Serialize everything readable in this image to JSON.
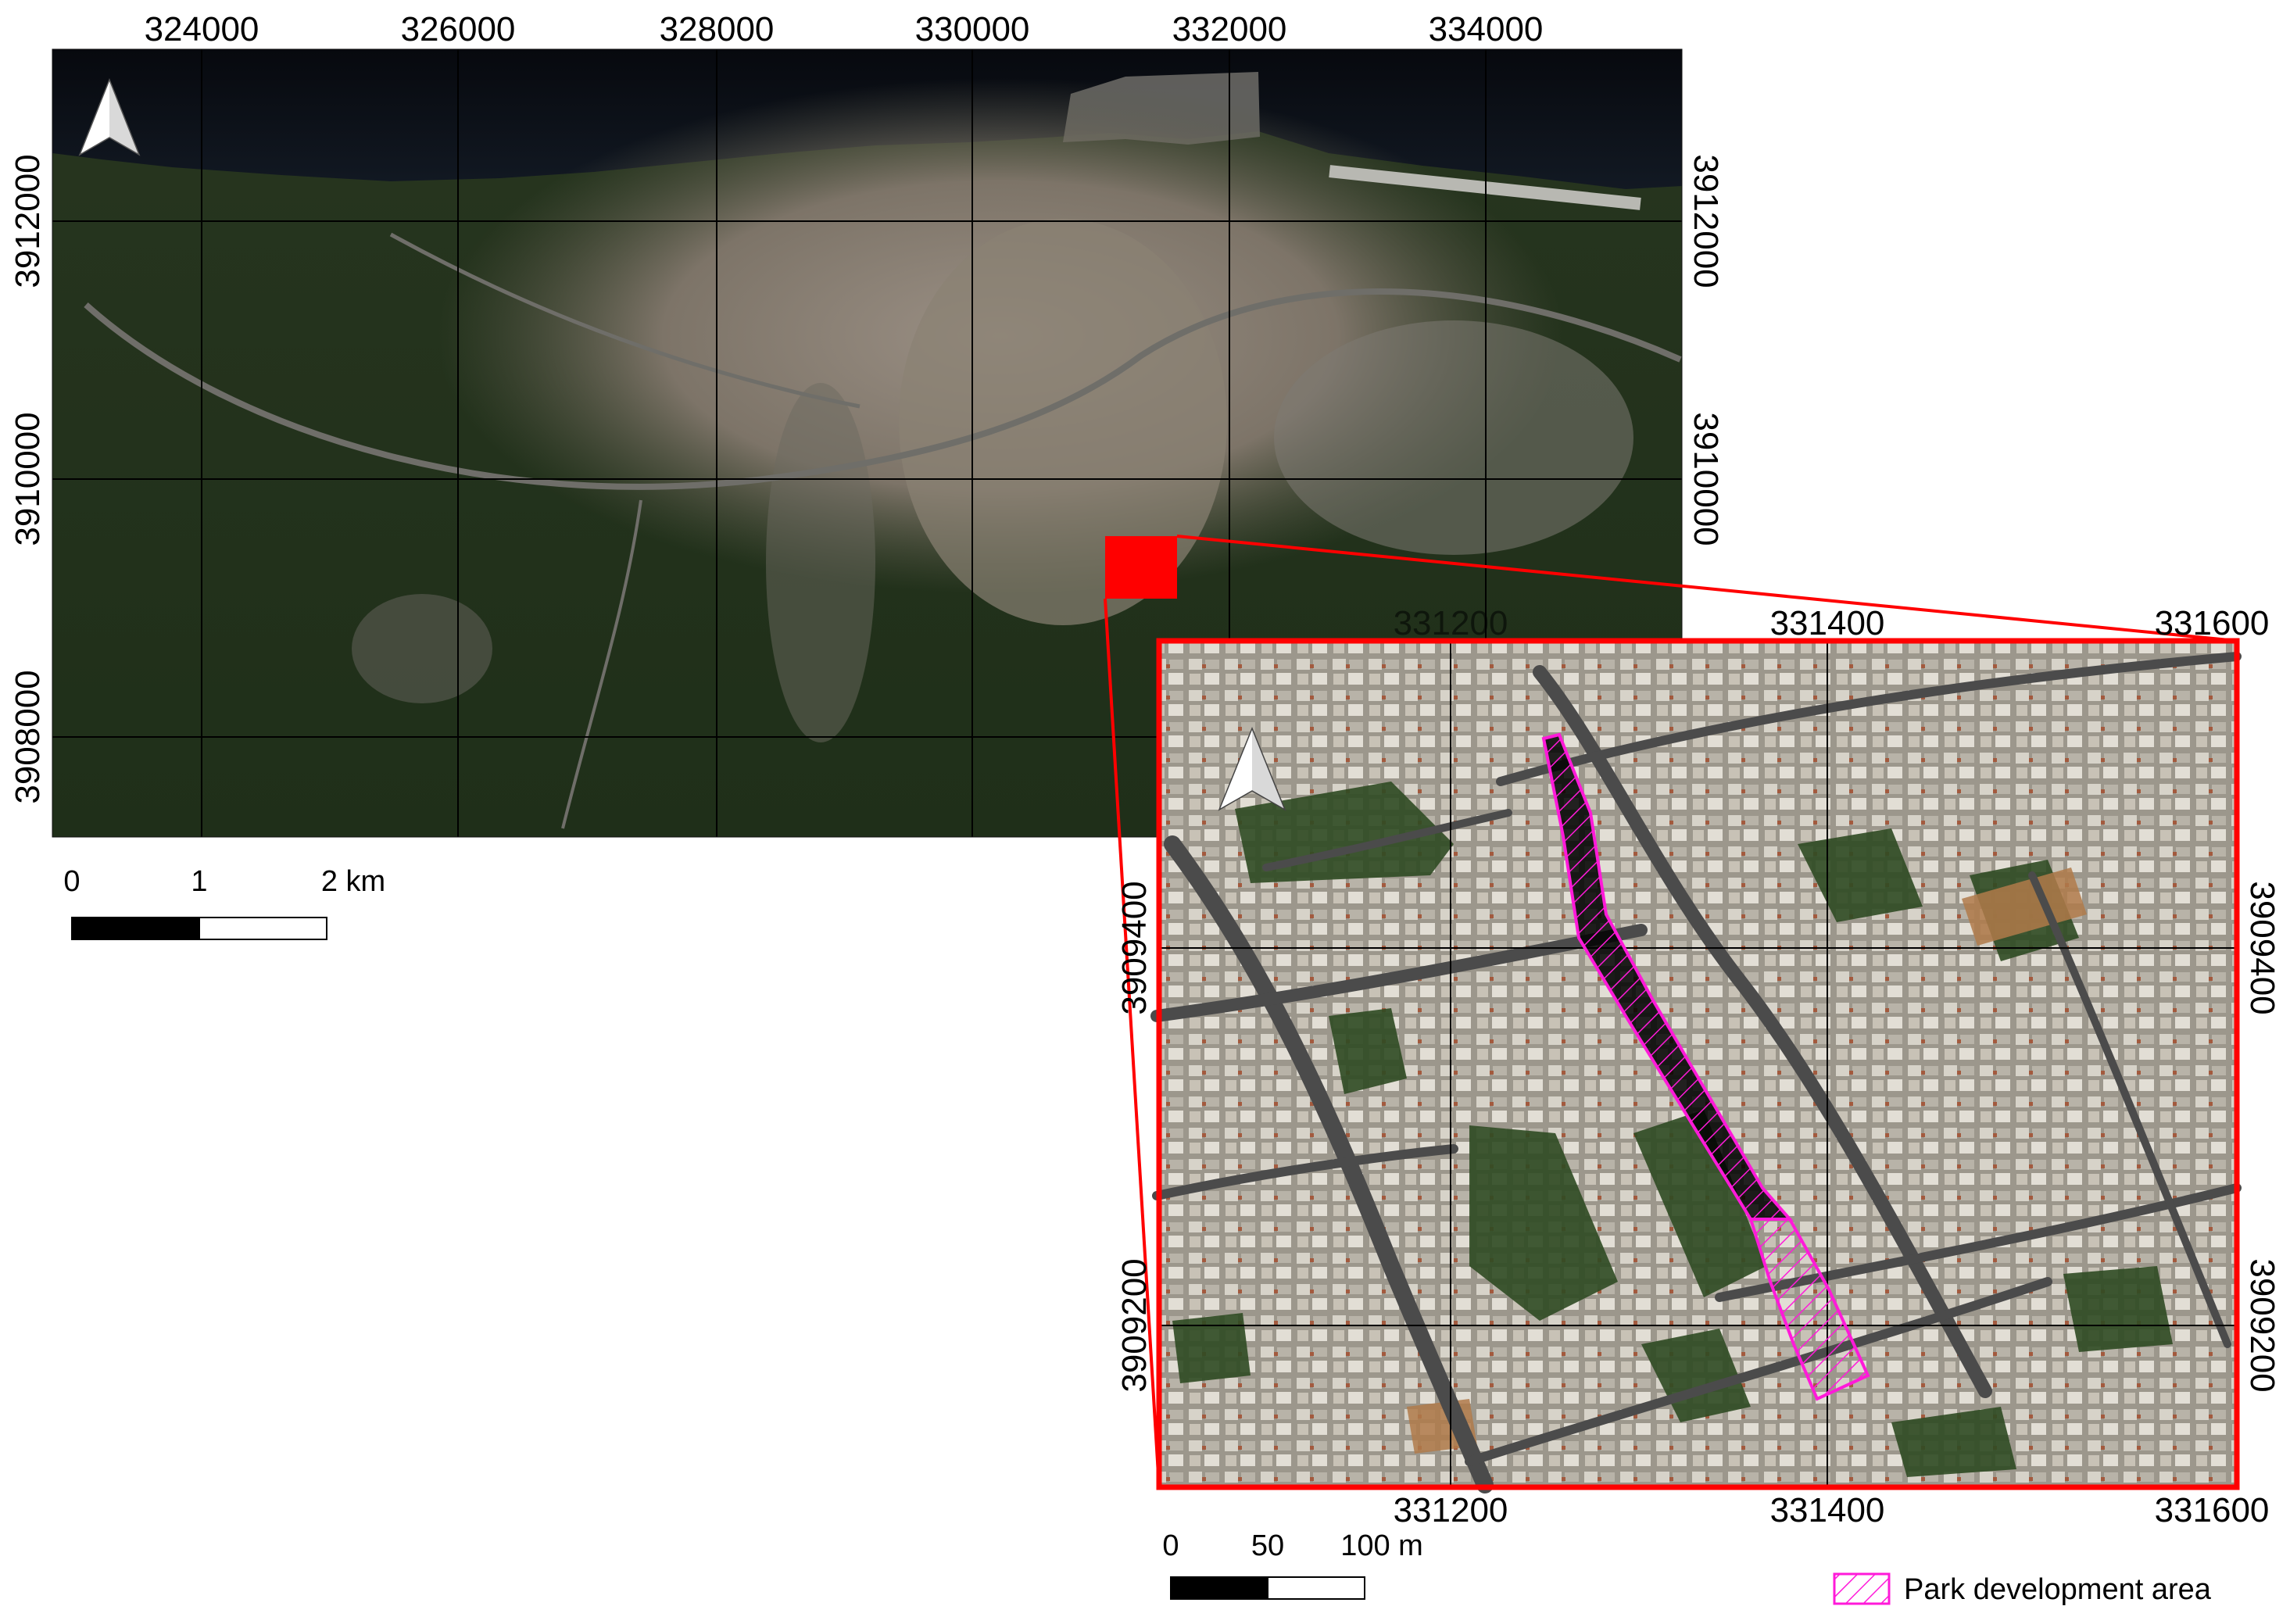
{
  "overview_map": {
    "x_ticks": [
      "324000",
      "326000",
      "328000",
      "330000",
      "332000",
      "334000"
    ],
    "y_ticks": [
      "3912000",
      "3910000",
      "3908000"
    ],
    "scalebar": {
      "labels": [
        "0",
        "1",
        "2 km"
      ]
    }
  },
  "inset_map": {
    "top_ticks": [
      "331200",
      "331400",
      "331600"
    ],
    "bottom_ticks": [
      "331200",
      "331400",
      "331600"
    ],
    "y_ticks": [
      "3909400",
      "3909200"
    ],
    "scalebar": {
      "labels": [
        "0",
        "50",
        "100 m"
      ]
    }
  },
  "legend": {
    "label": "Park development area",
    "color": "#ff1ad9"
  },
  "colors": {
    "extent_frame": "#ff0000",
    "sea": "#0b0d13",
    "vegetation": "#2a3d20",
    "urban": "#8c8276"
  },
  "icons": {
    "north_arrow": "north-arrow-icon",
    "legend_hatch": "hatched-polygon-icon"
  }
}
